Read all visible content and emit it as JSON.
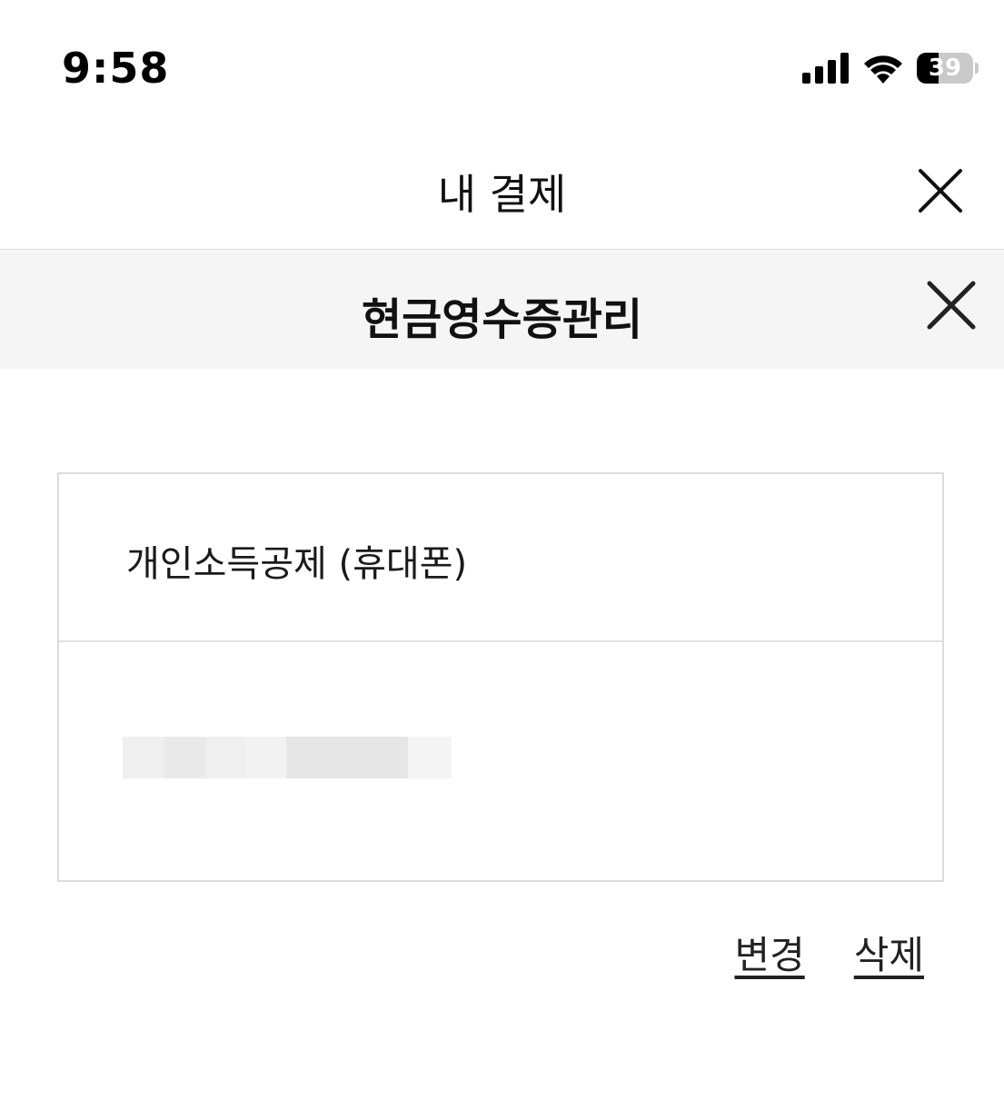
{
  "status_bar": {
    "time": "9:58",
    "battery_level": "39",
    "battery_fraction": 0.39,
    "icons": [
      "cellular-signal-icon",
      "wifi-icon",
      "battery-icon"
    ]
  },
  "header": {
    "title": "내 결제",
    "close_icon": "close-icon"
  },
  "subheader": {
    "title": "현금영수증관리",
    "close_icon": "close-icon"
  },
  "receipt_card": {
    "label": "개인소득공제 (휴대폰)",
    "value": ""
  },
  "actions": {
    "change_label": "변경",
    "delete_label": "삭제"
  },
  "colors": {
    "subheader_bg": "#f5f5f5",
    "border": "#dcdcdc",
    "text": "#111111"
  }
}
